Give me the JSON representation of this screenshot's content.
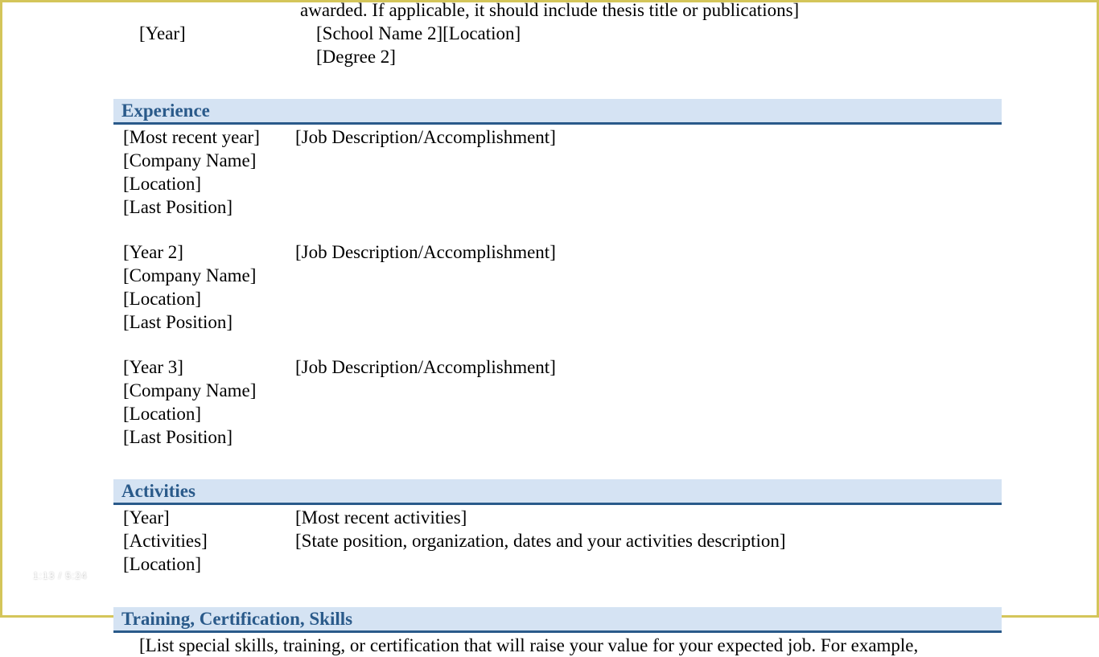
{
  "education": {
    "desc_cutoff": "awarded. If applicable, it should include thesis title or publications]",
    "year2": "[Year]",
    "school2": "[School Name 2]",
    "location2": "[Location]",
    "degree2": "[Degree 2]"
  },
  "experience": {
    "heading": "Experience",
    "items": [
      {
        "year": "[Most recent year]",
        "company": "[Company Name]",
        "location": "[Location]",
        "position": "[Last Position]",
        "desc": "[Job Description/Accomplishment]"
      },
      {
        "year": "[Year 2]",
        "company": "[Company Name]",
        "location": "[Location]",
        "position": "[Last Position]",
        "desc": "[Job Description/Accomplishment]"
      },
      {
        "year": "[Year 3]",
        "company": "[Company Name]",
        "location": "[Location]",
        "position": "[Last Position]",
        "desc": "[Job Description/Accomplishment]"
      }
    ]
  },
  "activities": {
    "heading": "Activities",
    "year": "[Year]",
    "name": "[Activities]",
    "location": "[Location]",
    "recent": "[Most recent activities]",
    "state": "[State position, organization, dates  and your activities description]"
  },
  "training": {
    "heading": "Training, Certification, Skills",
    "desc": "[List special skills, training, or certification that will raise your value for your expected job. For example,"
  },
  "overlay": {
    "time": "1:13 / 5:24"
  }
}
